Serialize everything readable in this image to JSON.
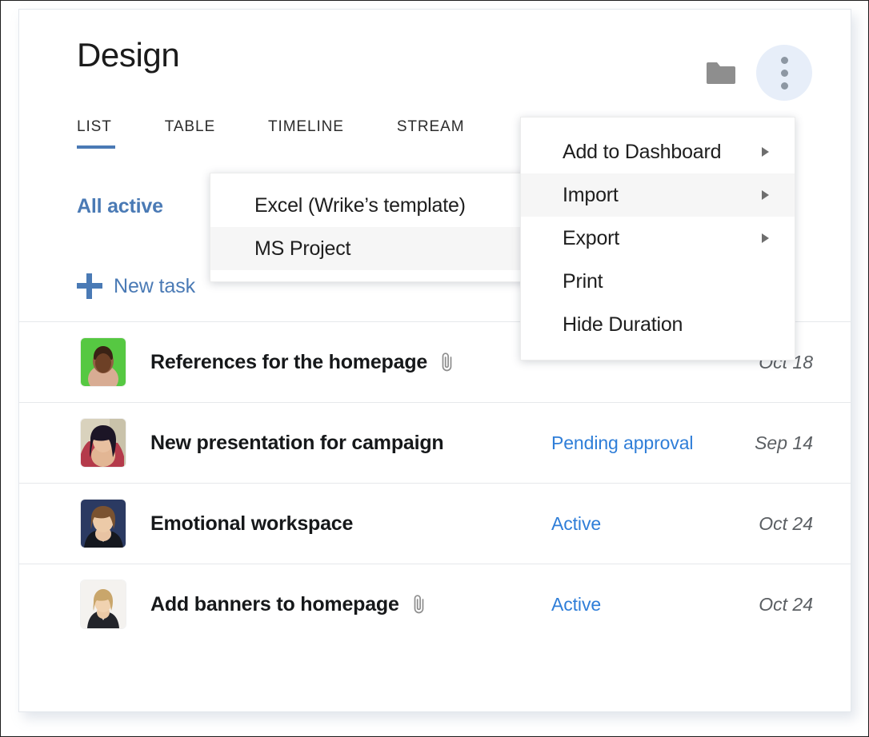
{
  "header": {
    "title": "Design",
    "folder_icon": "folder-icon",
    "kebab_icon": "more-options-icon"
  },
  "tabs": [
    {
      "label": "LIST",
      "active": true
    },
    {
      "label": "TABLE",
      "active": false
    },
    {
      "label": "TIMELINE",
      "active": false
    },
    {
      "label": "STREAM",
      "active": false
    }
  ],
  "filter": {
    "label": "All active"
  },
  "new_task": {
    "label": "New task",
    "icon": "plus-icon"
  },
  "tasks": [
    {
      "title": "References for the homepage",
      "has_attachment": true,
      "status": "",
      "date": "Oct 18",
      "avatar": "avatar-green"
    },
    {
      "title": "New presentation for campaign",
      "has_attachment": false,
      "status": "Pending approval",
      "date": "Sep 14",
      "avatar": "avatar-dark-hair"
    },
    {
      "title": "Emotional workspace",
      "has_attachment": false,
      "status": "Active",
      "date": "Oct 24",
      "avatar": "avatar-blue-bg"
    },
    {
      "title": "Add banners to homepage",
      "has_attachment": true,
      "status": "Active",
      "date": "Oct 24",
      "avatar": "avatar-white-bg"
    }
  ],
  "context_menu": {
    "items": [
      {
        "label": "Add to Dashboard",
        "submenu": true,
        "hovered": false
      },
      {
        "label": "Import",
        "submenu": true,
        "hovered": true
      },
      {
        "label": "Export",
        "submenu": true,
        "hovered": false
      },
      {
        "label": "Print",
        "submenu": false,
        "hovered": false
      },
      {
        "label": "Hide Duration",
        "submenu": false,
        "hovered": false
      }
    ]
  },
  "import_submenu": {
    "items": [
      {
        "label": "Excel (Wrike’s template)",
        "hovered": false
      },
      {
        "label": "MS Project",
        "hovered": true
      }
    ]
  },
  "colors": {
    "accent_blue": "#4a7ab5",
    "status_blue": "#2f7ed8",
    "kebab_bg": "#e7eef9",
    "folder_gray": "#8e8e8e",
    "divider": "#e6e8eb",
    "menu_hover": "#f6f6f6"
  }
}
